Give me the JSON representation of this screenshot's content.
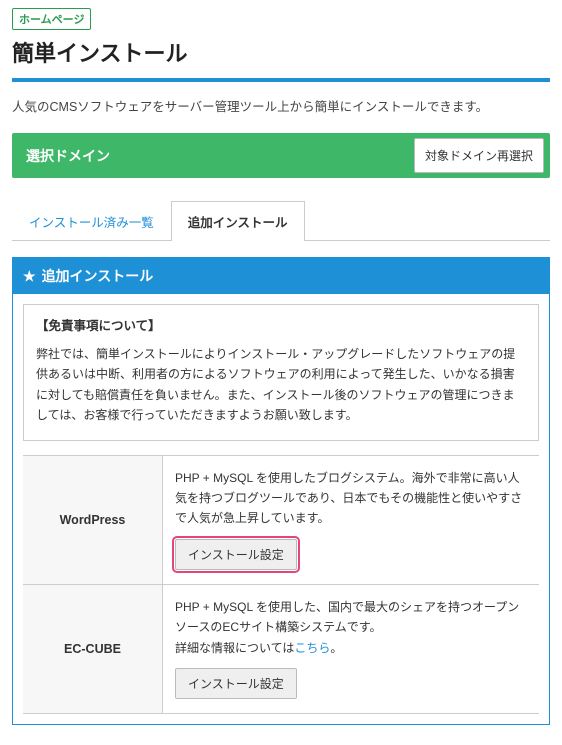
{
  "header": {
    "tag_label": "ホームページ",
    "title": "簡単インストール"
  },
  "intro": "人気のCMSソフトウェアをサーバー管理ツール上から簡単にインストールできます。",
  "domain_bar": {
    "label": "選択ドメイン",
    "reselect_label": "対象ドメイン再選択"
  },
  "tabs": {
    "installed_list": "インストール済み一覧",
    "add_install": "追加インストール"
  },
  "module": {
    "title": "追加インストール",
    "star_glyph": "★"
  },
  "disclaimer": {
    "title": "【免責事項について】",
    "body": "弊社では、簡単インストールによりインストール・アップグレードしたソフトウェアの提供あるいは中断、利用者の方によるソフトウェアの利用によって発生した、いかなる損害に対しても賠償責任を負いません。また、インストール後のソフトウェアの管理につきましては、お客様で行っていただきますようお願い致します。"
  },
  "software": {
    "install_button_label": "インストール設定",
    "wordpress": {
      "name": "WordPress",
      "desc": "PHP + MySQL を使用したブログシステム。海外で非常に高い人気を持つブログツールであり、日本でもその機能性と使いやすさで人気が急上昇しています。"
    },
    "eccube": {
      "name": "EC-CUBE",
      "desc_prefix": "PHP + MySQL を使用した、国内で最大のシェアを持つオープンソースのECサイト構築システムです。",
      "desc_details_prefix": "詳細な情報については",
      "desc_details_link": "こちら",
      "desc_details_suffix": "。"
    }
  }
}
